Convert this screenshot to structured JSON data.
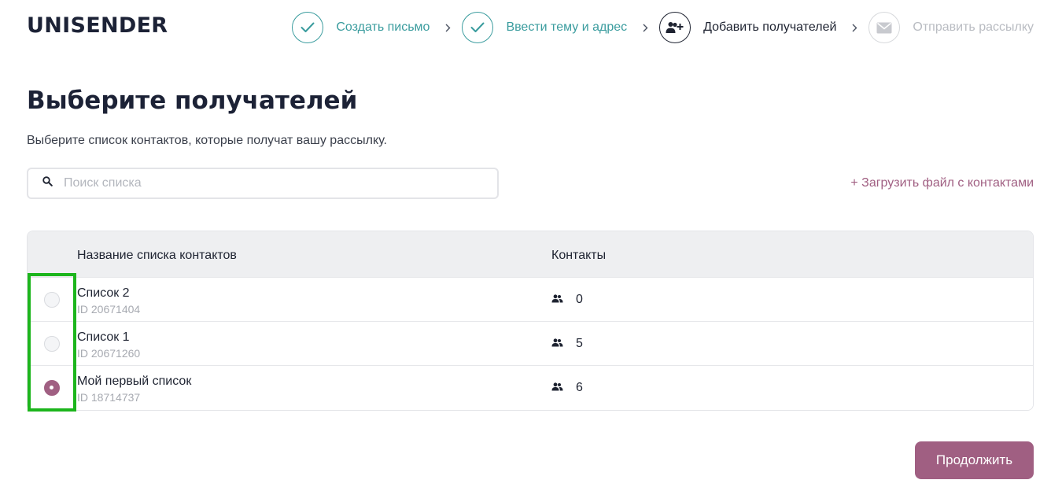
{
  "brand": {
    "logo": "UNISENDER"
  },
  "steps": [
    {
      "label": "Создать письмо",
      "state": "done",
      "icon": "check-icon"
    },
    {
      "label": "Ввести тему и адрес",
      "state": "done",
      "icon": "check-icon"
    },
    {
      "label": "Добавить получателей",
      "state": "current",
      "icon": "add-user-icon"
    },
    {
      "label": "Отправить рассылку",
      "state": "pending",
      "icon": "envelope-icon"
    }
  ],
  "page": {
    "title": "Выберите получателей",
    "subtitle": "Выберите список контактов, которые получат вашу рассылку."
  },
  "search": {
    "placeholder": "Поиск списка",
    "value": ""
  },
  "upload_link": "+ Загрузить файл с контактами",
  "table": {
    "headers": {
      "name": "Название списка контактов",
      "contacts": "Контакты"
    },
    "rows": [
      {
        "name": "Список 2",
        "id": "ID 20671404",
        "contacts": "0",
        "selected": false
      },
      {
        "name": "Список 1",
        "id": "ID 20671260",
        "contacts": "5",
        "selected": false
      },
      {
        "name": "Мой первый список",
        "id": "ID 18714737",
        "contacts": "6",
        "selected": true
      }
    ]
  },
  "continue_button": "Продолжить",
  "colors": {
    "accent": "#a05f82",
    "done_step": "#3a9c9e",
    "highlight": "#1cb51c",
    "text": "#1e2331"
  }
}
